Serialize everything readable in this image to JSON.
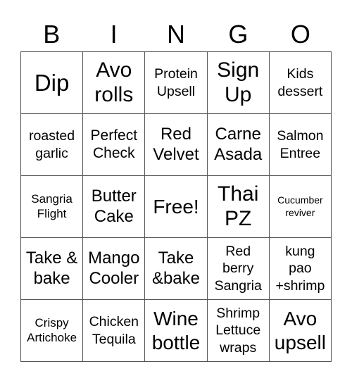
{
  "header": {
    "letters": [
      "B",
      "I",
      "N",
      "G",
      "O"
    ]
  },
  "card": {
    "rows": [
      [
        "Dip",
        "Avo\nrolls",
        "Protein\nUpsell",
        "Sign\nUp",
        "Kids\ndessert"
      ],
      [
        "roasted\ngarlic",
        "Perfect\nCheck",
        "Red\nVelvet",
        "Carne\nAsada",
        "Salmon\nEntree"
      ],
      [
        "Sangria\nFlight",
        "Butter\nCake",
        "Free!",
        "Thai\nPZ",
        "Cucumber\nreviver"
      ],
      [
        "Take &\nbake",
        "Mango\nCooler",
        "Take\n&bake",
        "Red\nberry\nSangria",
        "kung\npao\n+shrimp"
      ],
      [
        "Crispy\nArtichoke",
        "Chicken\nTequila",
        "Wine\nbottle",
        "Shrimp\nLettuce\nwraps",
        "Avo\nupsell"
      ]
    ]
  }
}
